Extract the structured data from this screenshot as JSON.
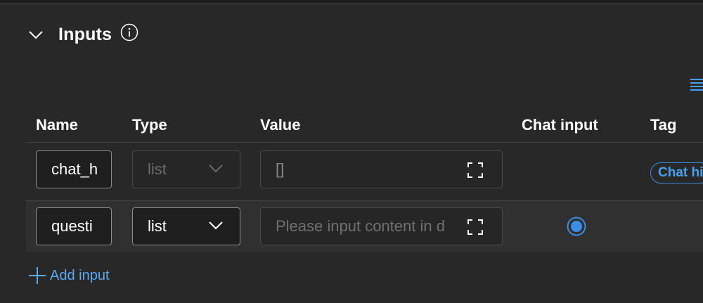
{
  "section": {
    "title": "Inputs",
    "collapse_icon": "chevron-down-icon",
    "info_icon": "info-icon"
  },
  "toolbar": {
    "list_view_icon": "list-view-icon"
  },
  "table": {
    "columns": [
      "Name",
      "Type",
      "Value",
      "Chat input",
      "Tag"
    ],
    "rows": [
      {
        "name": "chat_h",
        "type": "list",
        "type_enabled": false,
        "value": "[]",
        "value_placeholder": "",
        "chat_input": false,
        "tag": "Chat hi"
      },
      {
        "name": "questi",
        "type": "list",
        "type_enabled": true,
        "value": "",
        "value_placeholder": "Please input content in d",
        "chat_input": true,
        "tag": ""
      }
    ]
  },
  "actions": {
    "add_input_label": "Add input"
  },
  "colors": {
    "accent": "#3a8ee6",
    "link": "#5aa9f2",
    "panel_bg": "#282828"
  }
}
